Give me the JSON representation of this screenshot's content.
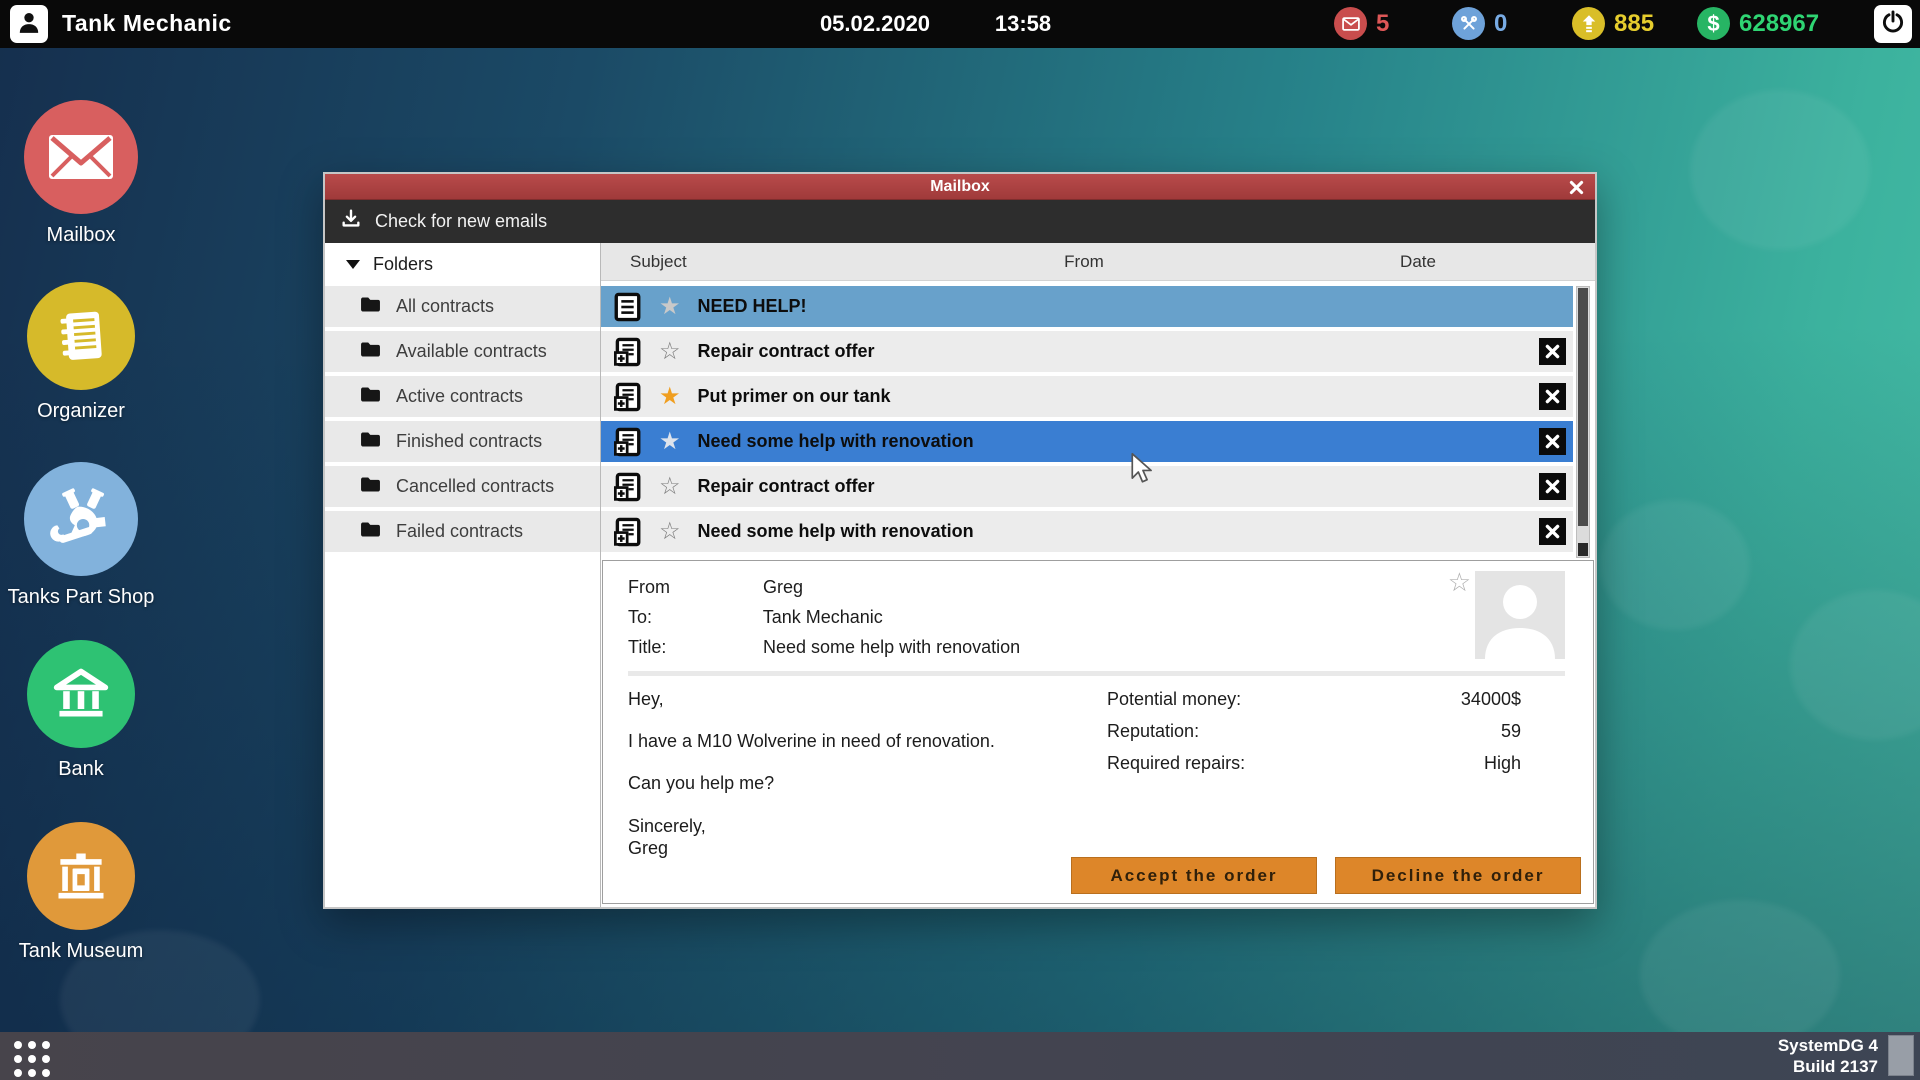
{
  "topbar": {
    "app_title": "Tank Mechanic",
    "date": "05.02.2020",
    "time": "13:58",
    "mail_count": "5",
    "repairs_count": "0",
    "rank_points": "885",
    "money": "628967",
    "money_symbol": "$",
    "colors": {
      "mail": "#c94d4d",
      "repairs": "#6ea2d9",
      "rank": "#d9be28",
      "money": "#27b564"
    }
  },
  "desktop": {
    "icons": [
      {
        "label": "Mailbox"
      },
      {
        "label": "Organizer"
      },
      {
        "label": "Tanks Part Shop"
      },
      {
        "label": "Bank"
      },
      {
        "label": "Tank Museum"
      }
    ]
  },
  "mailbox_window": {
    "title": "Mailbox",
    "toolbar": {
      "check_for_new_emails": "Check for new emails"
    },
    "folders": {
      "header": "Folders",
      "items": [
        "All contracts",
        "Available contracts",
        "Active contracts",
        "Finished contracts",
        "Cancelled contracts",
        "Failed contracts"
      ]
    },
    "list": {
      "columns": {
        "subject": "Subject",
        "from": "From",
        "date": "Date"
      },
      "rows": [
        {
          "subject": "NEED HELP!",
          "icon": "doc-lines",
          "star": "gray-filled",
          "state": "highlighted",
          "closable": false
        },
        {
          "subject": "Repair contract offer",
          "icon": "doc-plus",
          "star": "outline",
          "state": "normal",
          "closable": true
        },
        {
          "subject": "Put primer on our tank",
          "icon": "doc-plus",
          "star": "orange-filled",
          "state": "normal",
          "closable": true
        },
        {
          "subject": "Need some help with renovation",
          "icon": "doc-plus",
          "star": "light-filled",
          "state": "selected",
          "closable": true
        },
        {
          "subject": "Repair contract offer",
          "icon": "doc-plus",
          "star": "outline",
          "state": "normal",
          "closable": true
        },
        {
          "subject": "Need some help with renovation",
          "icon": "doc-plus",
          "star": "outline",
          "state": "normal",
          "closable": true
        }
      ]
    },
    "detail": {
      "from_label": "From",
      "from_value": "Greg",
      "to_label": "To:",
      "to_value": "Tank Mechanic",
      "title_label": "Title:",
      "title_value": "Need some help with renovation",
      "body_lines": [
        "Hey,",
        "I have a M10 Wolverine in need of renovation.",
        "Can you help me?",
        "Sincerely,",
        "Greg"
      ],
      "stats": [
        {
          "label": "Potential money:",
          "value": "34000$"
        },
        {
          "label": "Reputation:",
          "value": "59"
        },
        {
          "label": "Required repairs:",
          "value": "High"
        }
      ],
      "accept_button": "Accept the order",
      "decline_button": "Decline the order"
    }
  },
  "taskbar": {
    "system_name": "SystemDG 4",
    "build": "Build 2137"
  }
}
